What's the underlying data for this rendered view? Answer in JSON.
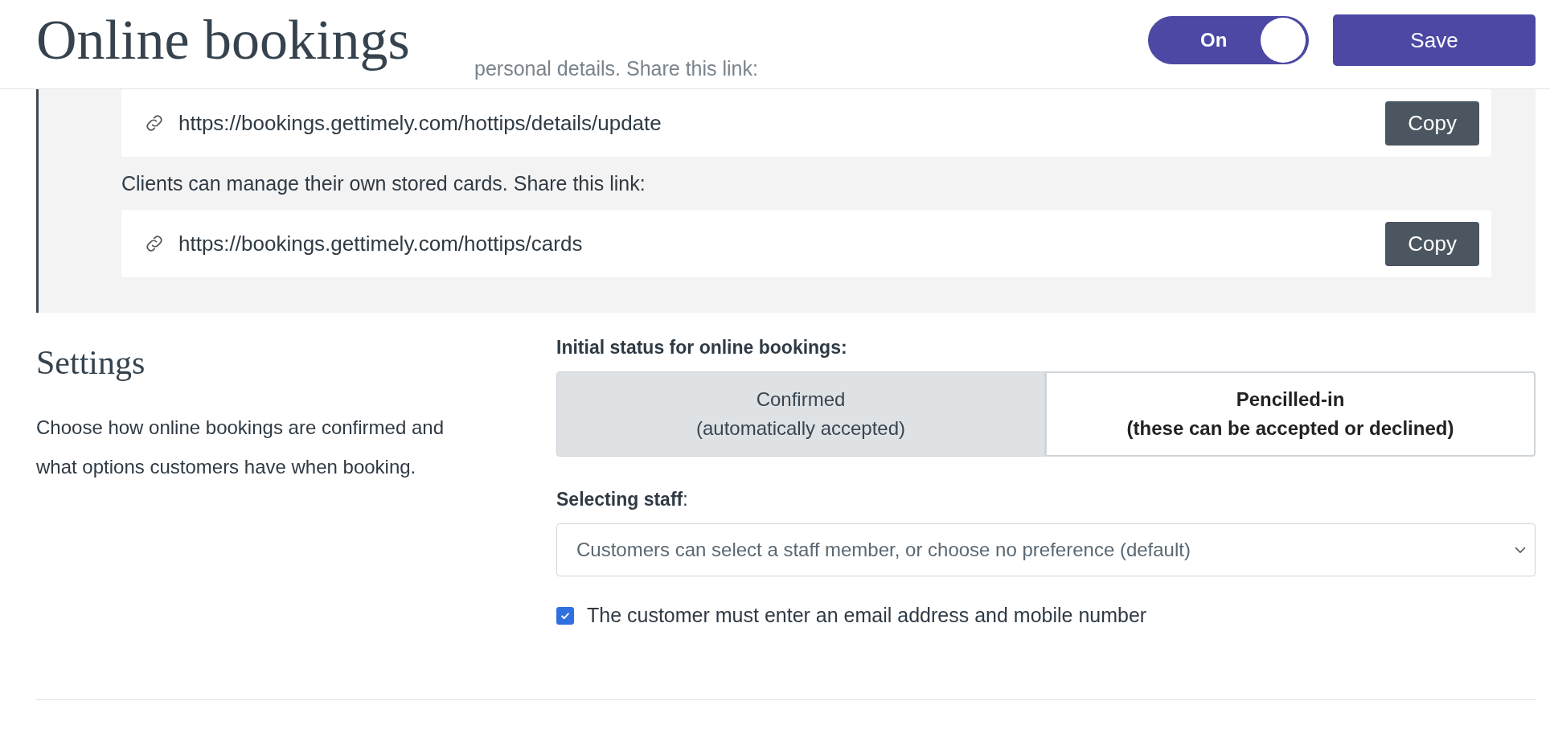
{
  "header": {
    "title": "Online bookings",
    "toggle": {
      "label": "On",
      "on": true
    },
    "save_button": "Save"
  },
  "obscured_caption": "personal details. Share this link:",
  "share_panel": [
    {
      "kind": "link",
      "url": "https://bookings.gettimely.com/hottips/details/update",
      "button": "Copy"
    },
    {
      "kind": "caption",
      "text": "Clients can manage their own stored cards. Share this link:"
    },
    {
      "kind": "link",
      "url": "https://bookings.gettimely.com/hottips/cards",
      "button": "Copy"
    }
  ],
  "settings": {
    "heading": "Settings",
    "description": "Choose how online bookings are confirmed and what options customers have when booking.",
    "status_label": "Initial status for online bookings:",
    "status_options": [
      {
        "title": "Confirmed",
        "subtitle": "(automatically accepted)",
        "selected": false
      },
      {
        "title": "Pencilled-in",
        "subtitle": "(these can be accepted or declined)",
        "selected": true
      }
    ],
    "staff_label": "**Selecting staff**:",
    "staff_select": "Customers can select a staff member, or choose no preference (default)",
    "contact_checkbox": {
      "label": "The customer must enter an email address and mobile number",
      "checked": true
    }
  }
}
